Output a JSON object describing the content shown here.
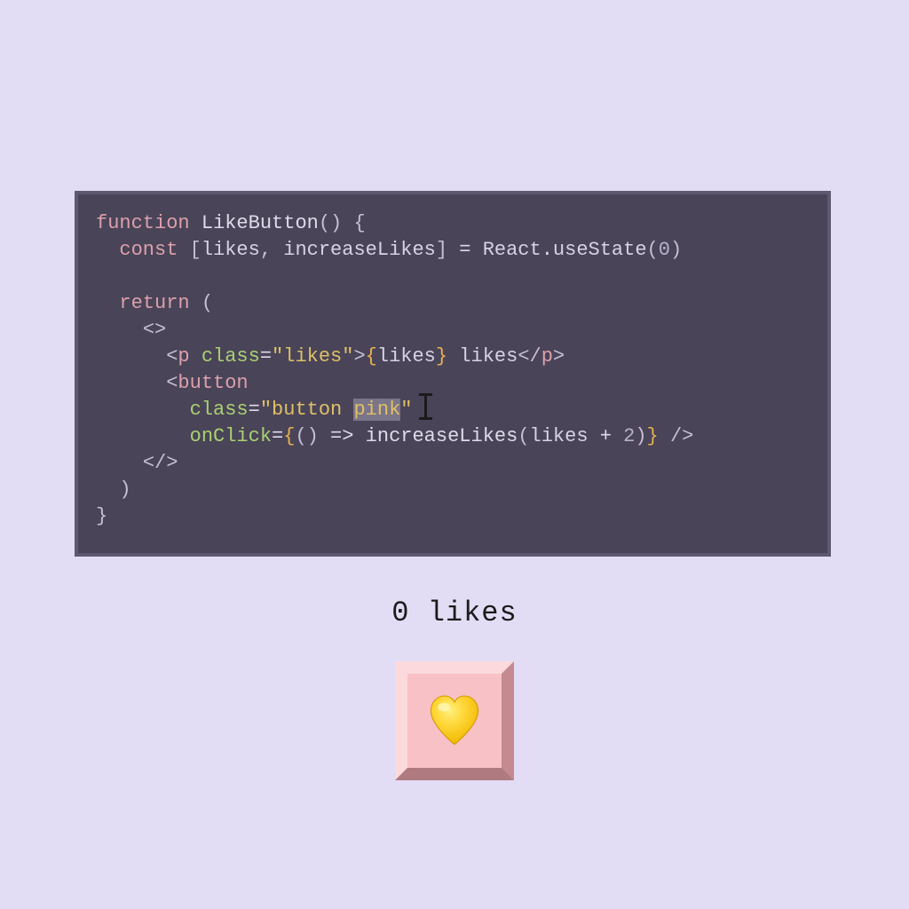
{
  "code": {
    "line1": {
      "function": "function",
      "name": "LikeButton",
      "parens": "()",
      "brace": " {"
    },
    "line2": {
      "indent": "  ",
      "const": "const",
      "space": " ",
      "lbracket": "[",
      "likes": "likes",
      "comma": ", ",
      "setter": "increaseLikes",
      "rbracket": "]",
      "eq": " = ",
      "react": "React",
      "dot": ".",
      "usestate": "useState",
      "lparen": "(",
      "zero": "0",
      "rparen": ")"
    },
    "line4": {
      "indent": "  ",
      "return": "return",
      "space": " ",
      "lparen": "("
    },
    "line5": {
      "indent": "    ",
      "frag": "<>"
    },
    "line6": {
      "indent": "      ",
      "lt": "<",
      "p": "p",
      "space": " ",
      "class": "class",
      "eq": "=",
      "str": "\"likes\"",
      "gt": ">",
      "jlbrace": "{",
      "likes": "likes",
      "jrbrace": "}",
      "text": " likes",
      "ltslash": "</",
      "p2": "p",
      "gt2": ">"
    },
    "line7": {
      "indent": "      ",
      "lt": "<",
      "button": "button"
    },
    "line8": {
      "indent": "        ",
      "class": "class",
      "eq": "=",
      "q1": "\"",
      "button": "button ",
      "p": "p",
      "ink": "ink",
      "q2": "\""
    },
    "line9": {
      "indent": "        ",
      "onclick": "onClick",
      "eq": "=",
      "jlbrace": "{",
      "parens": "()",
      "arrow": " => ",
      "func": "increaseLikes",
      "lparen": "(",
      "likes": "likes",
      "plus": " + ",
      "two": "2",
      "rparen": ")",
      "jrbrace": "}",
      "close": " />"
    },
    "line10": {
      "indent": "    ",
      "fragclose": "</>"
    },
    "line11": {
      "indent": "  ",
      "rparen": ")"
    },
    "line12": {
      "brace": "}"
    }
  },
  "output": {
    "likes_count": "0",
    "likes_word": " likes"
  },
  "button": {
    "heart_emoji": "💛"
  }
}
